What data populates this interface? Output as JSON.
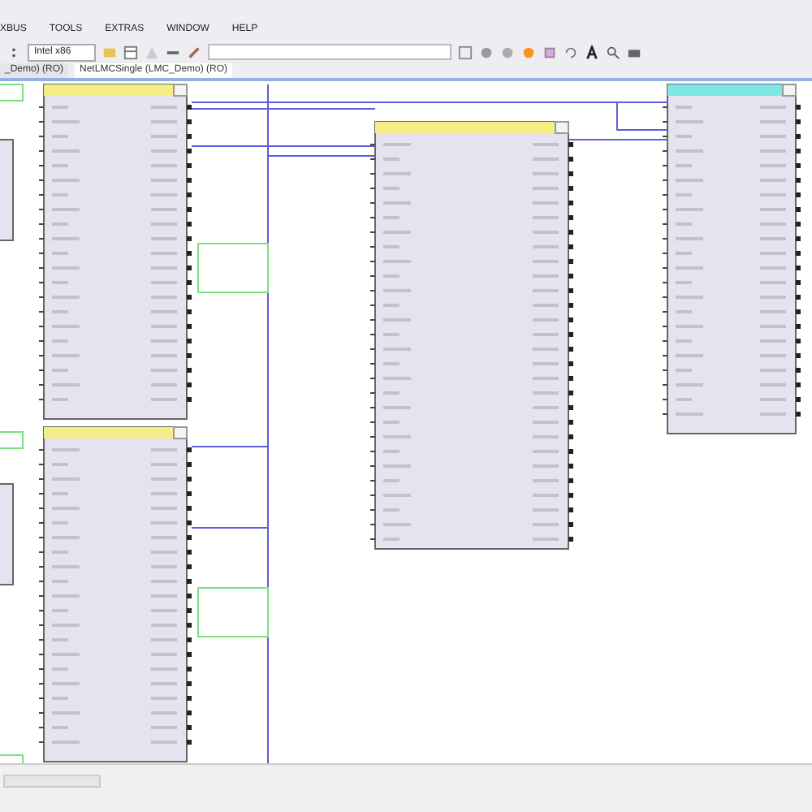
{
  "menu": [
    {
      "label": "XBUS"
    },
    {
      "label": "TOOLS"
    },
    {
      "label": "EXTRAS"
    },
    {
      "label": "WINDOW"
    },
    {
      "label": "HELP"
    }
  ],
  "toolbar": {
    "target_select": "Intel x86"
  },
  "doc_tabs": [
    {
      "label": "_Demo) (RO)",
      "selected": false
    },
    {
      "label": "NetLMCSingle (LMC_Demo) (RO)",
      "selected": true
    }
  ],
  "blocks": [
    {
      "color": "#f3ef86"
    },
    {
      "color": "#f3ef86"
    },
    {
      "color": "#f3ef86"
    },
    {
      "color": "#7fe6e6"
    }
  ]
}
